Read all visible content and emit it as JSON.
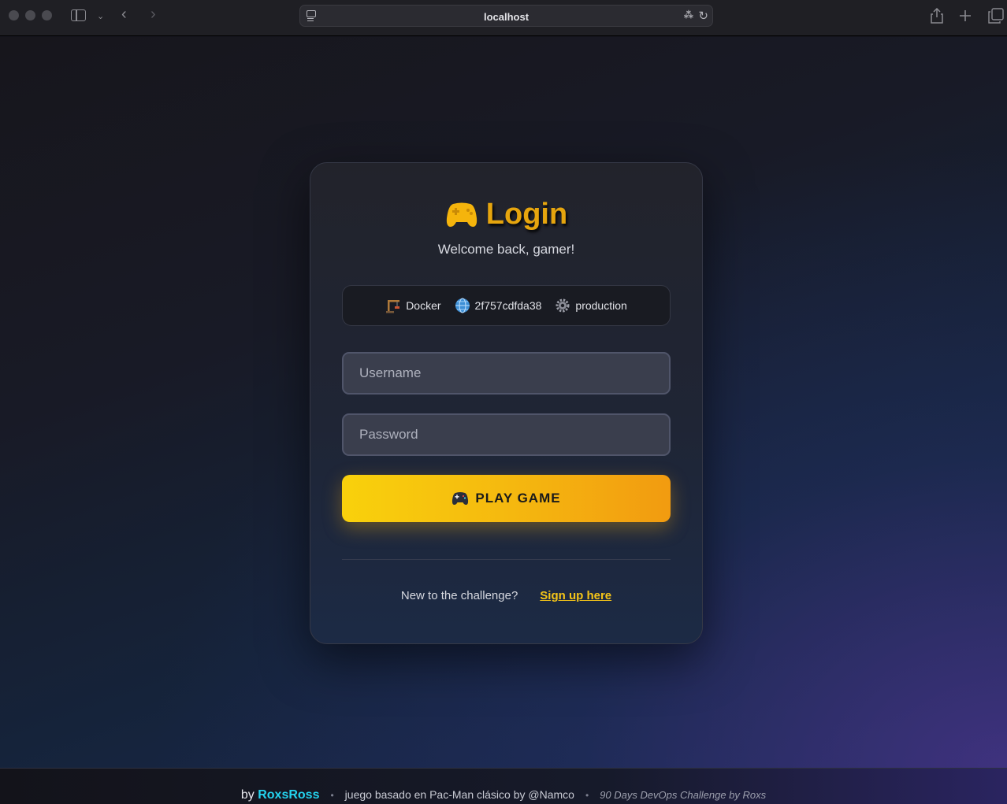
{
  "browser": {
    "url": "localhost",
    "icons": [
      "sidebar-icon",
      "chevron-down-icon",
      "back-icon",
      "forward-icon",
      "translate-icon",
      "reload-icon",
      "share-icon",
      "new-tab-icon",
      "tabs-overview-icon"
    ]
  },
  "login": {
    "title": "Login",
    "subtitle": "Welcome back, gamer!",
    "env": {
      "platform": "Docker",
      "host": "2f757cdfda38",
      "mode": "production"
    },
    "username_placeholder": "Username",
    "password_placeholder": "Password",
    "play_label": "PLAY GAME",
    "signup_text": "New to the challenge?",
    "signup_link": "Sign up here"
  },
  "footer": {
    "by_prefix": "by",
    "author": "RoxsRoss",
    "separator": "•",
    "game_credit": "juego basado en Pac-Man clásico by @Namco",
    "challenge_credit": "90 Days DevOps Challenge by Roxs"
  },
  "colors": {
    "accent": "#f5c518",
    "title_gold": "#e6a50e",
    "author_cyan": "#24d3ef",
    "button_gradient": [
      "#f9d10c",
      "#f29b10"
    ]
  }
}
